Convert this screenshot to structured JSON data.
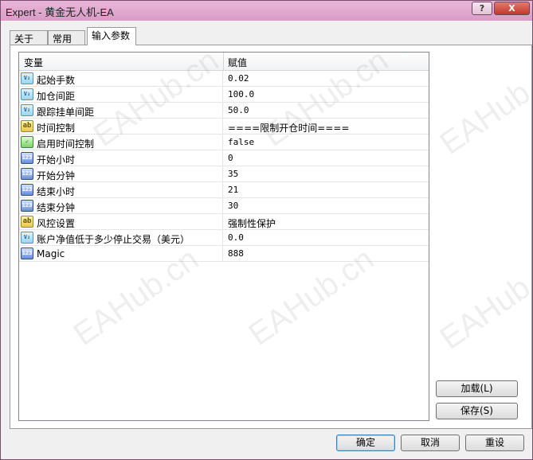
{
  "window": {
    "title": "Expert - 黄金无人机-EA",
    "help_label": "?",
    "close_label": "X"
  },
  "tabs": [
    {
      "label": "关于",
      "active": false
    },
    {
      "label": "常用",
      "active": false
    },
    {
      "label": "输入参数",
      "active": true
    }
  ],
  "grid": {
    "headers": {
      "variable": "变量",
      "value": "赋值"
    },
    "rows": [
      {
        "type_icon": "double-icon",
        "icon_text": "V₂",
        "name": "起始手数",
        "value": "0.02"
      },
      {
        "type_icon": "double-icon",
        "icon_text": "V₂",
        "name": "加仓间距",
        "value": "100.0"
      },
      {
        "type_icon": "double-icon",
        "icon_text": "V₂",
        "name": "跟踪挂单间距",
        "value": "50.0"
      },
      {
        "type_icon": "string-icon",
        "icon_text": "ab",
        "name": "时间控制",
        "value": "====限制开仓时间===="
      },
      {
        "type_icon": "bool-icon",
        "icon_text": "✓",
        "name": "启用时间控制",
        "value": "false"
      },
      {
        "type_icon": "int-icon",
        "icon_text": "123",
        "name": "开始小时",
        "value": "0"
      },
      {
        "type_icon": "int-icon",
        "icon_text": "123",
        "name": "开始分钟",
        "value": "35"
      },
      {
        "type_icon": "int-icon",
        "icon_text": "123",
        "name": "结束小时",
        "value": "21"
      },
      {
        "type_icon": "int-icon",
        "icon_text": "123",
        "name": "结束分钟",
        "value": "30"
      },
      {
        "type_icon": "string-icon",
        "icon_text": "ab",
        "name": "风控设置",
        "value": "强制性保护"
      },
      {
        "type_icon": "double-icon",
        "icon_text": "V₂",
        "name": "账户净值低于多少停止交易（美元）",
        "value": "0.0"
      },
      {
        "type_icon": "int-icon",
        "icon_text": "123",
        "name": "Magic",
        "value": "888"
      }
    ]
  },
  "side_buttons": {
    "load": "加载(L)",
    "save": "保存(S)"
  },
  "bottom_buttons": {
    "ok": "确定",
    "cancel": "取消",
    "reset": "重设"
  },
  "watermark_text": "EAHub.cn"
}
